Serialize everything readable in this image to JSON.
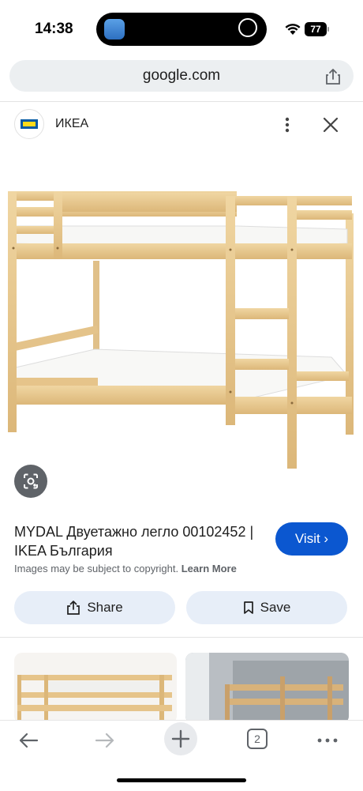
{
  "status": {
    "time": "14:38",
    "battery": "77"
  },
  "browser": {
    "url": "google.com",
    "tab_count": "2"
  },
  "result": {
    "site_name": "ИКЕА",
    "title": "MYDAL Двуетажно легло 00102452 | IKEA България",
    "visit_label": "Visit",
    "copyright_text": "Images may be subject to copyright.",
    "learn_more": "Learn More",
    "share_label": "Share",
    "save_label": "Save"
  },
  "colors": {
    "accent": "#0b57d0",
    "pill_bg": "#e7eef8",
    "wood": "#e8c88e"
  }
}
